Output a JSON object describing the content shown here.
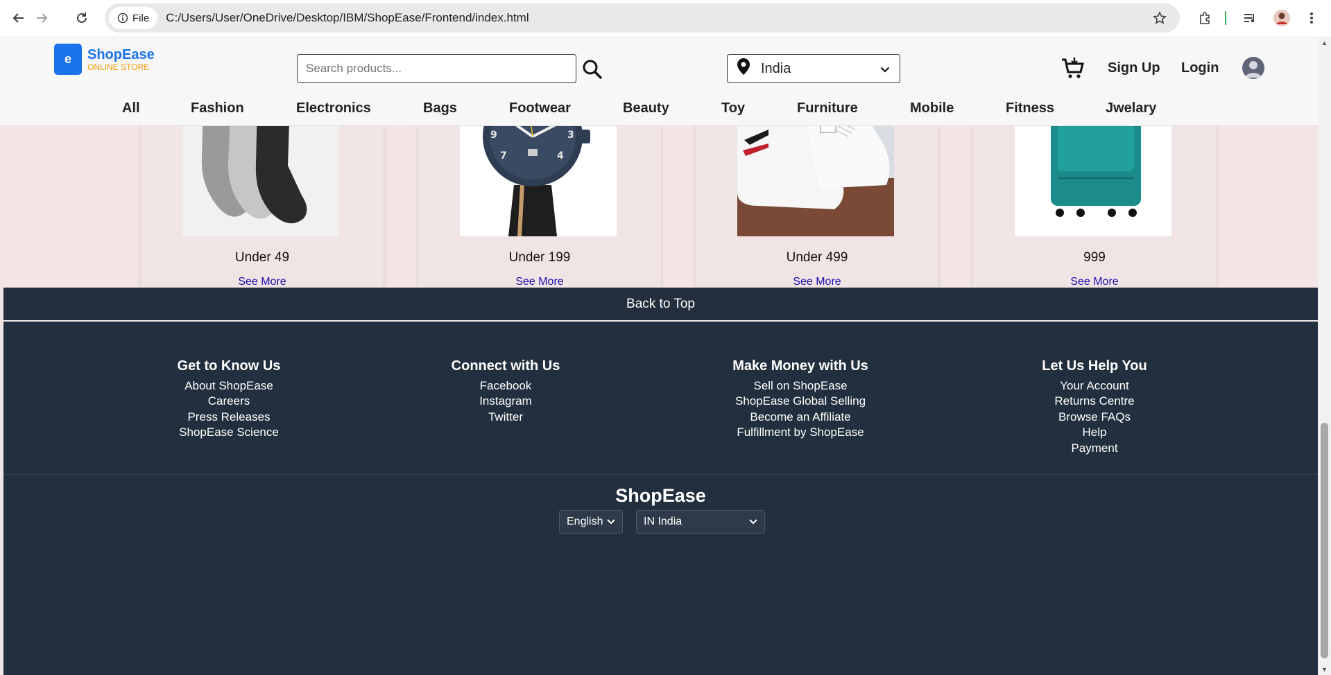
{
  "browser": {
    "file_chip": "File",
    "url": "C:/Users/User/OneDrive/Desktop/IBM/ShopEase/Frontend/index.html"
  },
  "header": {
    "logo_letter": "e",
    "logo_name": "ShopEase",
    "logo_sub": "ONLINE STORE",
    "search_placeholder": "Search products...",
    "country": "India",
    "signup": "Sign Up",
    "login": "Login"
  },
  "categories": [
    "All",
    "Fashion",
    "Electronics",
    "Bags",
    "Footwear",
    "Beauty",
    "Toy",
    "Furniture",
    "Mobile",
    "Fitness",
    "Jwelary"
  ],
  "cards": [
    {
      "title": "Under 49",
      "link": "See More",
      "image": "socks"
    },
    {
      "title": "Under 199",
      "link": "See More",
      "image": "watch"
    },
    {
      "title": "Under 499",
      "link": "See More",
      "image": "sneakers"
    },
    {
      "title": "999",
      "link": "See More",
      "image": "suitcase"
    }
  ],
  "footer": {
    "back_to_top": "Back to Top",
    "columns": [
      {
        "heading": "Get to Know Us",
        "links": [
          "About ShopEase",
          "Careers",
          "Press Releases",
          "ShopEase Science"
        ]
      },
      {
        "heading": "Connect with Us",
        "links": [
          "Facebook",
          "Instagram",
          "Twitter"
        ]
      },
      {
        "heading": "Make Money with Us",
        "links": [
          "Sell on ShopEase",
          "ShopEase Global Selling",
          "Become an Affiliate",
          "Fulfillment by ShopEase"
        ]
      },
      {
        "heading": "Let Us Help You",
        "links": [
          "Your Account",
          "Returns Centre",
          "Browse FAQs",
          "Help",
          "Payment"
        ]
      }
    ],
    "brand": "ShopEase",
    "language": "English",
    "region": "IN India"
  }
}
